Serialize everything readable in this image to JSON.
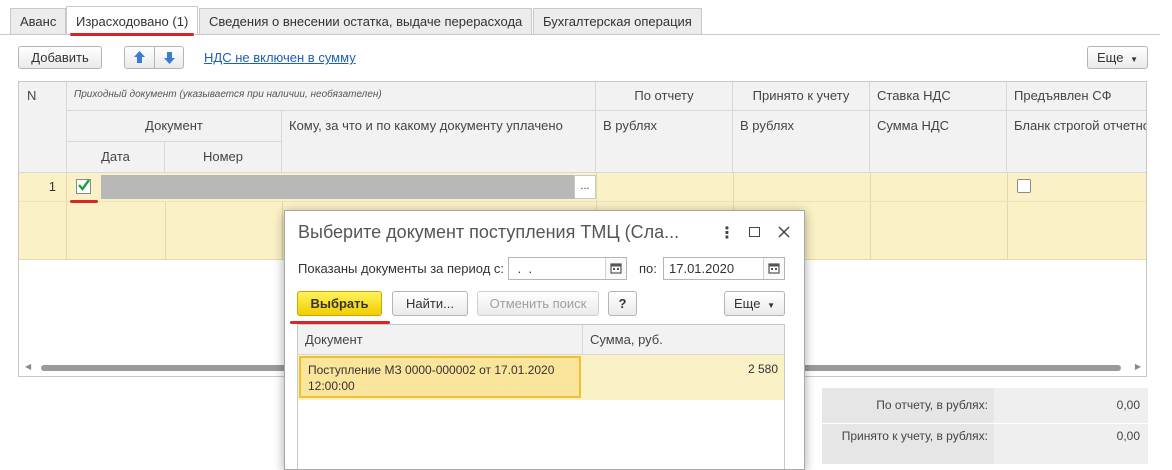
{
  "tabs": [
    {
      "label": "Аванс"
    },
    {
      "label": "Израсходовано (1)"
    },
    {
      "label": "Сведения о внесении остатка, выдаче перерасхода"
    },
    {
      "label": "Бухгалтерская операция"
    }
  ],
  "toolbar": {
    "add_label": "Добавить",
    "vat_link": "НДС не включен в сумму",
    "more_label": "Еще"
  },
  "grid": {
    "headers": {
      "n": "N",
      "incoming_doc": "Приходный документ (указывается при наличии, необязателен)",
      "document": "Документ",
      "date": "Дата",
      "number": "Номер",
      "paid_to": "Кому, за что и по какому документу уплачено",
      "by_report": "По отчету",
      "by_report_sub": "В рублях",
      "accepted": "Принято к учету",
      "accepted_sub": "В рублях",
      "vat_rate": "Ставка НДС",
      "vat_sum": "Сумма НДС",
      "invoice": "Предъявлен СФ",
      "strict_form": "Бланк строгой отчетно"
    },
    "rows": [
      {
        "n": "1",
        "checked": true,
        "select_dots": "..."
      }
    ]
  },
  "totals": {
    "by_report_label": "По отчету, в рублях:",
    "by_report_value": "0,00",
    "accepted_label": "Принято к учету, в рублях:",
    "accepted_value": "0,00"
  },
  "dialog": {
    "title": "Выберите документ поступления ТМЦ (Сла...",
    "period_label": "Показаны документы за период с:",
    "date_from": " .  .",
    "to_label": "по:",
    "date_to": "17.01.2020",
    "select_label": "Выбрать",
    "find_label": "Найти...",
    "cancel_search_label": "Отменить поиск",
    "help_label": "?",
    "more_label": "Еще",
    "columns": [
      "Документ",
      "Сумма, руб."
    ],
    "rows": [
      {
        "document_line1": "Поступление МЗ 0000-000002 от 17.01.2020",
        "document_line2": "12:00:00",
        "amount": "2 580"
      }
    ]
  },
  "colors": {
    "row_highlight": "#fbf1c7",
    "selected_cell": "#fbe49b",
    "accent_red": "#d82525",
    "link_blue": "#1d5fb8",
    "primary_yellow": "#f7de1c"
  }
}
